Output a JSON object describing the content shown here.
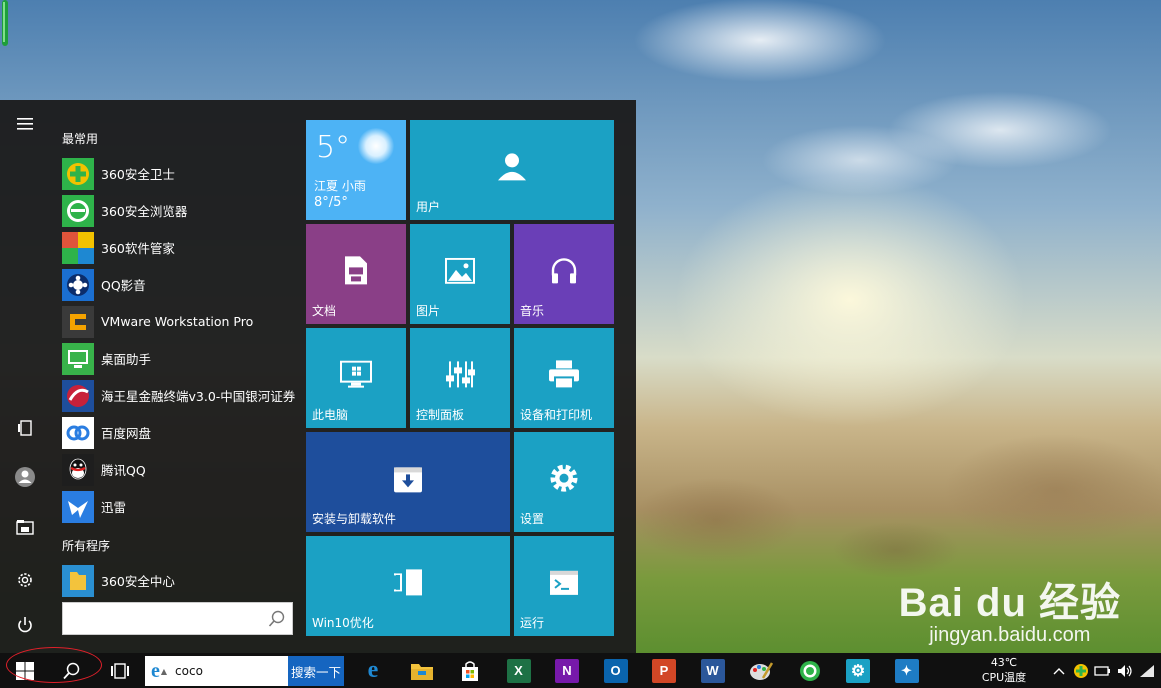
{
  "start_menu": {
    "most_used_label": "最常用",
    "all_programs_label": "所有程序",
    "most_used": [
      {
        "label": "360安全卫士",
        "icon": "360-safeguard-icon",
        "color": "#2eb34a"
      },
      {
        "label": "360安全浏览器",
        "icon": "360-browser-icon",
        "color": "#2eb34a"
      },
      {
        "label": "360软件管家",
        "icon": "360-software-manager-icon",
        "color": "#e0543b"
      },
      {
        "label": "QQ影音",
        "icon": "qq-player-icon",
        "color": "#1b6fd1"
      },
      {
        "label": "VMware Workstation Pro",
        "icon": "vmware-icon",
        "color": "#f5a300"
      },
      {
        "label": "桌面助手",
        "icon": "desktop-assistant-icon",
        "color": "#38b34a"
      },
      {
        "label": "海王星金融终端v3.0-中国银河证券",
        "icon": "neptune-finance-icon",
        "color": "#c8213a"
      },
      {
        "label": "百度网盘",
        "icon": "baidu-netdisk-icon",
        "color": "#ffffff"
      },
      {
        "label": "腾讯QQ",
        "icon": "tencent-qq-icon",
        "color": "#1e1e1e"
      },
      {
        "label": "迅雷",
        "icon": "xunlei-icon",
        "color": "#2a7de1"
      }
    ],
    "all_programs": [
      {
        "label": "360安全中心",
        "icon": "folder-icon",
        "color": "#f3c33c"
      }
    ],
    "rail": [
      {
        "name": "hamburger-menu-icon",
        "glyph": "≡"
      },
      {
        "name": "tablet-mode-icon",
        "glyph": "▯"
      },
      {
        "name": "user-account-icon",
        "glyph": "●"
      },
      {
        "name": "file-explorer-icon",
        "glyph": "▤"
      },
      {
        "name": "settings-gear-icon",
        "glyph": "⚙"
      },
      {
        "name": "power-icon",
        "glyph": "⏻"
      }
    ]
  },
  "tiles": {
    "weather": {
      "temp": "5°",
      "city": "江夏 小雨",
      "range": "8°/5°",
      "color": "#4db3f5"
    },
    "users": {
      "label": "用户",
      "color": "#1ba1c4"
    },
    "documents": {
      "label": "文档",
      "color": "#8a3f87"
    },
    "pictures": {
      "label": "图片",
      "color": "#1ba1c4"
    },
    "music": {
      "label": "音乐",
      "color": "#6a3fb7"
    },
    "this_pc": {
      "label": "此电脑",
      "color": "#1ba1c4"
    },
    "control_panel": {
      "label": "控制面板",
      "color": "#1ba1c4"
    },
    "devices_printers": {
      "label": "设备和打印机",
      "color": "#1ba1c4"
    },
    "install_uninstall": {
      "label": "安装与卸载软件",
      "color": "#1e4e9c"
    },
    "settings": {
      "label": "设置",
      "color": "#1ba1c4"
    },
    "win10_optimize": {
      "label": "Win10优化",
      "color": "#1ba1c4"
    },
    "run": {
      "label": "运行",
      "color": "#1ba1c4"
    }
  },
  "taskbar": {
    "search_text": "coco",
    "search_button": "搜索一下",
    "cpu_temp_value": "43℃",
    "cpu_temp_label": "CPU温度",
    "apps": [
      {
        "name": "edge-browser-icon",
        "glyph": "e",
        "color": "#1e88d2"
      },
      {
        "name": "file-explorer-taskbar-icon",
        "glyph": "▬",
        "color": "#f3c33c"
      },
      {
        "name": "store-icon",
        "glyph": "🛍",
        "color": "#ffffff"
      },
      {
        "name": "excel-icon",
        "glyph": "X",
        "color": "#1e7145"
      },
      {
        "name": "onenote-icon",
        "glyph": "N",
        "color": "#7719aa"
      },
      {
        "name": "outlook-icon",
        "glyph": "O",
        "color": "#0a64ad"
      },
      {
        "name": "powerpoint-icon",
        "glyph": "P",
        "color": "#d24726"
      },
      {
        "name": "word-icon",
        "glyph": "W",
        "color": "#2b579a"
      },
      {
        "name": "paint-icon",
        "glyph": "🎨",
        "color": "#888888"
      },
      {
        "name": "360-browser-taskbar-icon",
        "glyph": "e",
        "color": "#2eb34a"
      },
      {
        "name": "settings-taskbar-icon",
        "glyph": "⚙",
        "color": "#1ba1c4"
      },
      {
        "name": "utility-app-icon",
        "glyph": "✦",
        "color": "#1e7cc4"
      }
    ]
  },
  "watermark": {
    "main": "Bai du 经验",
    "sub": "jingyan.baidu.com"
  }
}
